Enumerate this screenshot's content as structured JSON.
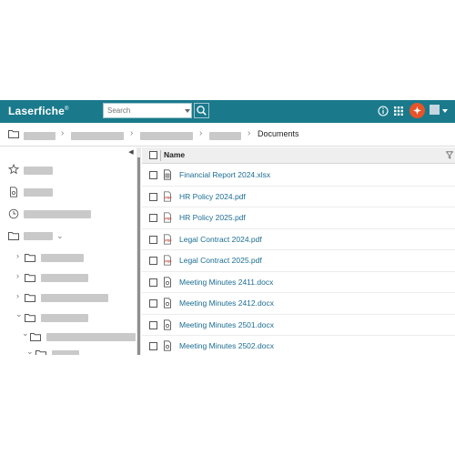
{
  "header": {
    "logo": "Laserfiche",
    "search": {
      "placeholder": "Search",
      "value": ""
    }
  },
  "breadcrumb": {
    "current": "Documents"
  },
  "list": {
    "column_name": "Name",
    "items": [
      {
        "name": "Financial Report 2024.xlsx",
        "icon": "spreadsheet-file-icon"
      },
      {
        "name": "HR Policy 2024.pdf",
        "icon": "pdf-file-icon"
      },
      {
        "name": "HR Policy 2025.pdf",
        "icon": "pdf-file-icon"
      },
      {
        "name": "Legal Contract 2024.pdf",
        "icon": "pdf-file-icon"
      },
      {
        "name": "Legal Contract 2025.pdf",
        "icon": "pdf-file-icon"
      },
      {
        "name": "Meeting Minutes 2411.docx",
        "icon": "document-file-icon"
      },
      {
        "name": "Meeting Minutes 2412.docx",
        "icon": "document-file-icon"
      },
      {
        "name": "Meeting Minutes 2501.docx",
        "icon": "document-file-icon"
      },
      {
        "name": "Meeting Minutes 2502.docx",
        "icon": "document-file-icon"
      }
    ]
  },
  "colors": {
    "header_bg": "#1a7a8c",
    "link": "#1b6d92",
    "avatar": "#e8542a",
    "pdf_red": "#c0392b"
  }
}
